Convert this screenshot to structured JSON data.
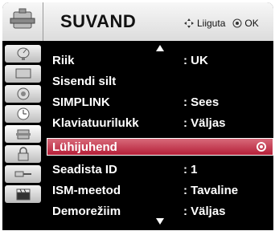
{
  "header": {
    "title": "SUVAND",
    "move_hint": "Liiguta",
    "ok_hint": "OK",
    "move_icon": "dpad-icon",
    "ok_icon": "ok-button-icon"
  },
  "sidebar": {
    "items": [
      {
        "icon": "satellite-dish-icon"
      },
      {
        "icon": "picture-icon"
      },
      {
        "icon": "speaker-icon"
      },
      {
        "icon": "clock-icon"
      },
      {
        "icon": "options-toolbox-icon"
      },
      {
        "icon": "lock-icon"
      },
      {
        "icon": "input-plug-icon"
      },
      {
        "icon": "clapperboard-icon"
      }
    ]
  },
  "menu": {
    "rows": [
      {
        "label": "Riik",
        "value": ": UK"
      },
      {
        "label": "Sisendi silt",
        "value": ""
      },
      {
        "label": "SIMPLINK",
        "value": ": Sees"
      },
      {
        "label": "Klaviatuurilukk",
        "value": ": Väljas"
      },
      {
        "label": "Lühijuhend",
        "value": ""
      },
      {
        "label": "Seadista ID",
        "value": ": 1"
      },
      {
        "label": "ISM-meetod",
        "value": ": Tavaline"
      },
      {
        "label": "Demorežiim",
        "value": ": Väljas"
      }
    ],
    "selected_index": 4,
    "colors": {
      "selected_bg": "#c0344a",
      "text": "#ffffff",
      "background": "#000000"
    }
  }
}
